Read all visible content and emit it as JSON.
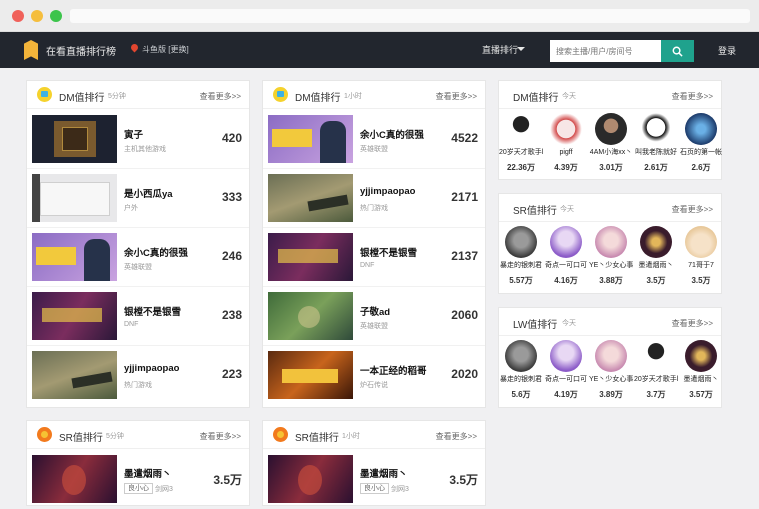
{
  "browser": {
    "dot_colors": [
      "#f0615a",
      "#f5be3d",
      "#3cc44b"
    ]
  },
  "nav": {
    "title": "在看直播排行榜",
    "location": "斗鱼版 [更换]",
    "rank_menu": "直播排行",
    "search_placeholder": "搜索主播/用户/房间号",
    "login": "登录",
    "accent": "#1fa28d"
  },
  "dm5": {
    "title": "DM值排行",
    "sub": "5分钟",
    "more": "查看更多>>",
    "rows": [
      {
        "name": "寅子",
        "cat": "主机其他游戏",
        "val": "420"
      },
      {
        "name": "是小西瓜ya",
        "cat": "户外",
        "val": "333"
      },
      {
        "name": "余小C真的很强",
        "cat": "英雄联盟",
        "val": "246"
      },
      {
        "name": "银樘不是银雪",
        "cat": "DNF",
        "val": "238"
      },
      {
        "name": "yjjimpaopao",
        "cat": "热门游戏",
        "val": "223"
      }
    ]
  },
  "dm1h": {
    "title": "DM值排行",
    "sub": "1小时",
    "more": "查看更多>>",
    "rows": [
      {
        "name": "余小C真的很强",
        "cat": "英雄联盟",
        "val": "4522"
      },
      {
        "name": "yjjimpaopao",
        "cat": "热门游戏",
        "val": "2171"
      },
      {
        "name": "银樘不是银雪",
        "cat": "DNF",
        "val": "2137"
      },
      {
        "name": "子敬ad",
        "cat": "英雄联盟",
        "val": "2060"
      },
      {
        "name": "一本正经的稻哥",
        "cat": "炉石传说",
        "val": "2020"
      }
    ]
  },
  "sr5": {
    "title": "SR值排行",
    "sub": "5分钟",
    "more": "查看更多>>",
    "row": {
      "name": "墨遣烟雨丶",
      "tag": "良小心",
      "sub": "剑网3",
      "val": "3.5万"
    }
  },
  "sr1h": {
    "title": "SR值排行",
    "sub": "1小时",
    "more": "查看更多>>",
    "row": {
      "name": "墨遣烟雨丶",
      "tag": "良小心",
      "sub": "剑网3",
      "val": "3.5万"
    }
  },
  "dmday": {
    "title": "DM值排行",
    "sub": "今天",
    "more": "查看更多>>",
    "users": [
      {
        "name": "20岁天才歌手l",
        "val": "22.36万"
      },
      {
        "name": "pigff",
        "val": "4.39万"
      },
      {
        "name": "4AM小海xx丶",
        "val": "3.01万"
      },
      {
        "name": "叫我老陈就好",
        "val": "2.61万"
      },
      {
        "name": "石页的第一帐",
        "val": "2.6万"
      }
    ]
  },
  "srday": {
    "title": "SR值排行",
    "sub": "今天",
    "more": "查看更多>>",
    "users": [
      {
        "name": "暴走的银刺君",
        "val": "5.57万"
      },
      {
        "name": "奇点一可口可",
        "val": "4.16万"
      },
      {
        "name": "YE丶少女心事",
        "val": "3.88万"
      },
      {
        "name": "墨遣烟雨丶",
        "val": "3.5万"
      },
      {
        "name": "71哥于7",
        "val": "3.5万"
      }
    ]
  },
  "lwday": {
    "title": "LW值排行",
    "sub": "今天",
    "more": "查看更多>>",
    "users": [
      {
        "name": "暴走的银刺君",
        "val": "5.6万"
      },
      {
        "name": "奇点一可口可",
        "val": "4.19万"
      },
      {
        "name": "YE丶少女心事",
        "val": "3.89万"
      },
      {
        "name": "20岁天才歌手l",
        "val": "3.7万"
      },
      {
        "name": "墨遣烟雨丶",
        "val": "3.57万"
      }
    ]
  }
}
